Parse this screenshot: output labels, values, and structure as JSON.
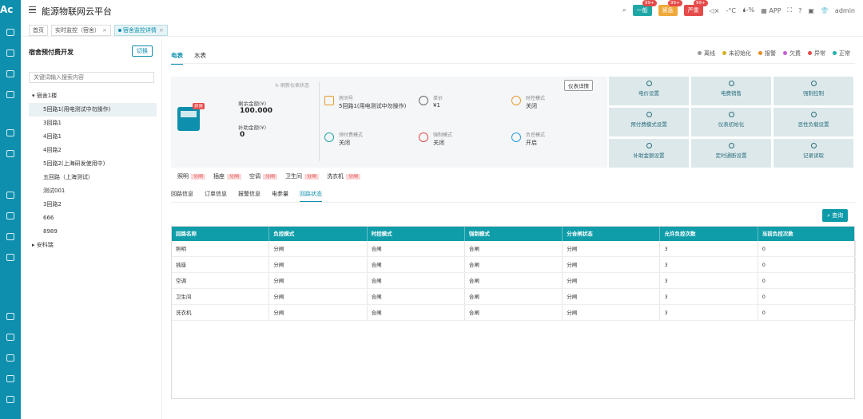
{
  "header": {
    "logo": "Ac",
    "title": "能源物联网云平台",
    "alarms": [
      {
        "label": "一般",
        "count": "99+",
        "color": "#1fa6a6"
      },
      {
        "label": "紧急",
        "count": "99+",
        "color": "#f0a93b"
      },
      {
        "label": "严重",
        "count": "99+",
        "color": "#e64a4a"
      }
    ],
    "app_label": "APP",
    "user": "admin"
  },
  "page_tabs": [
    {
      "label": "首页"
    },
    {
      "label": "实时监控（宿舍）",
      "close": "×"
    },
    {
      "label": "宿舍监控详情",
      "close": "×"
    }
  ],
  "left": {
    "title": "宿舍预付费开发",
    "switch": "切换",
    "search_placeholder": "关键词输入搜索内容",
    "tree": [
      {
        "label": "▾ 宿舍1楼",
        "indent": 0
      },
      {
        "label": "5回路1(用电测试中勿操作)",
        "indent": 1,
        "selected": true
      },
      {
        "label": "3回路1",
        "indent": 1
      },
      {
        "label": "4回路1",
        "indent": 1
      },
      {
        "label": "4回路2",
        "indent": 1
      },
      {
        "label": "5回路2(上海研发使用中)",
        "indent": 1
      },
      {
        "label": "五回路（上海测试）",
        "indent": 1
      },
      {
        "label": "测试001",
        "indent": 1
      },
      {
        "label": "3回路2",
        "indent": 1
      },
      {
        "label": "666",
        "indent": 1
      },
      {
        "label": "8989",
        "indent": 1
      },
      {
        "label": "▸ 安科瑞",
        "indent": 0
      }
    ]
  },
  "main": {
    "tabs": [
      {
        "label": "电表",
        "active": true
      },
      {
        "label": "水表"
      }
    ],
    "legend": [
      {
        "label": "离线",
        "color": "#9a9a9a"
      },
      {
        "label": "未初始化",
        "color": "#d4b21a"
      },
      {
        "label": "报警",
        "color": "#e98d1f"
      },
      {
        "label": "欠费",
        "color": "#c35cd4"
      },
      {
        "label": "异常",
        "color": "#e64a4a"
      },
      {
        "label": "正常",
        "color": "#1fb1b1"
      }
    ],
    "meter_badge": "异常",
    "refresh": "刷新仪表状态",
    "meter_detail": "仪表详情",
    "balance_label": "剩余金额(¥)",
    "balance_value": "100.000",
    "subsidy_label": "补助金额(¥)",
    "subsidy_value": "0",
    "info": {
      "room_label": "房间号",
      "room_value": "5回路1(用电测试中勿操作)",
      "price_label": "单价",
      "price_value": "¥1",
      "time_label": "时控模式",
      "time_value": "关闭",
      "prepay_label": "预付费模式",
      "prepay_value": "关闭",
      "force_label": "强制模式",
      "force_value": "关闭",
      "load_label": "负控模式",
      "load_value": "开启"
    },
    "loops": [
      {
        "name": "照明",
        "state": "分闸"
      },
      {
        "name": "插座",
        "state": "分闸"
      },
      {
        "name": "空调",
        "state": "分闸"
      },
      {
        "name": "卫生间",
        "state": "分闸"
      },
      {
        "name": "洗衣机",
        "state": "分闸"
      }
    ],
    "controls": [
      "电价设置",
      "电费销售",
      "强制控制",
      "预付费模式设置",
      "仪表初始化",
      "恶性负载设置",
      "补助金额设置",
      "定时通断设置",
      "记录读取"
    ],
    "subtabs": [
      "回路信息",
      "订单信息",
      "报警信息",
      "电参量",
      "回路状态"
    ],
    "active_subtab": 4,
    "query": "查询",
    "table": {
      "headers": [
        "回路名称",
        "负控模式",
        "时控模式",
        "强制模式",
        "分合闸状态",
        "允许负控次数",
        "当前负控次数"
      ],
      "rows": [
        [
          "照明",
          "分闸",
          "合闸",
          "合闸",
          "分闸",
          "3",
          "0"
        ],
        [
          "插座",
          "分闸",
          "合闸",
          "合闸",
          "分闸",
          "3",
          "0"
        ],
        [
          "空调",
          "分闸",
          "合闸",
          "合闸",
          "分闸",
          "3",
          "0"
        ],
        [
          "卫生间",
          "分闸",
          "合闸",
          "合闸",
          "分闸",
          "3",
          "0"
        ],
        [
          "洗衣机",
          "分闸",
          "合闸",
          "合闸",
          "分闸",
          "3",
          "0"
        ]
      ]
    }
  }
}
